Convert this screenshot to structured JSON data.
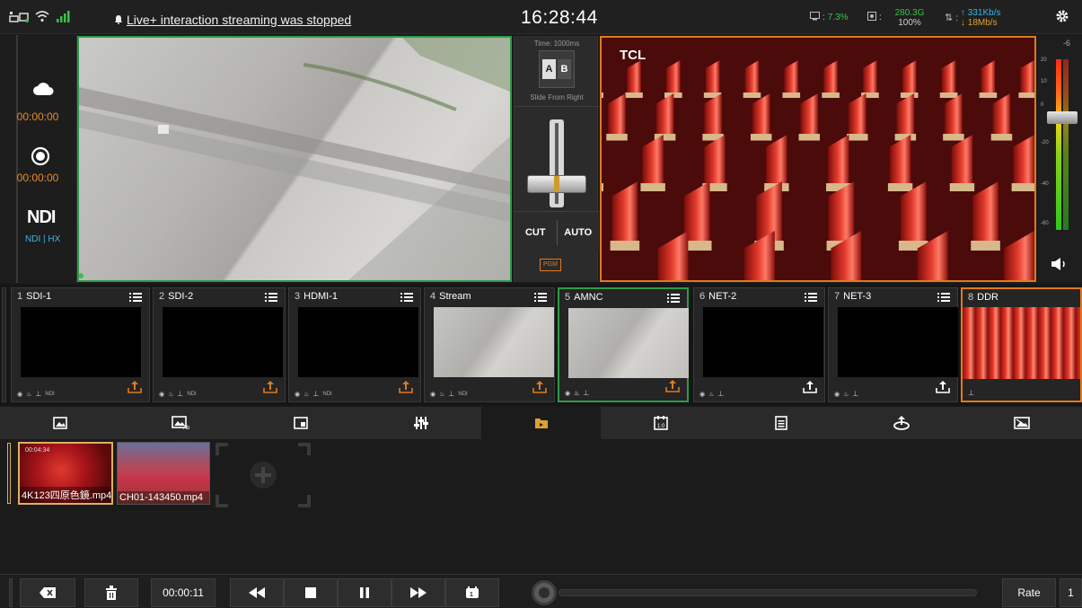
{
  "topbar": {
    "notice": "Live+ interaction streaming was stopped",
    "clock": "16:28:44",
    "cpu": "7.3%",
    "storage": "280.3G",
    "storage_pct": "100%",
    "upload": "331Kb/s",
    "download": "18Mb/s"
  },
  "left_panel": {
    "stream_time": "00:00:00",
    "record_time": "00:00:00",
    "ndi_logo": "NDI",
    "ndi_mode": "NDI | HX"
  },
  "transition": {
    "time": "Time: 1000ms",
    "a": "A",
    "b": "B",
    "effect": "Slide From Right",
    "cut": "CUT",
    "auto": "AUTO",
    "pgm": "PGM"
  },
  "program": {
    "brand": "TCL"
  },
  "audio": {
    "peak": "-6",
    "scale": [
      "20",
      "10",
      "0",
      "-20",
      "-40",
      "-60"
    ]
  },
  "sources": [
    {
      "num": "1",
      "name": "SDI-1",
      "tag": "NDI"
    },
    {
      "num": "2",
      "name": "SDI-2",
      "tag": "NDI"
    },
    {
      "num": "3",
      "name": "HDMI-1",
      "tag": "NDI"
    },
    {
      "num": "4",
      "name": "Stream",
      "tag": "NDI"
    },
    {
      "num": "5",
      "name": "AMNC",
      "tag": ""
    },
    {
      "num": "6",
      "name": "NET-2",
      "tag": ""
    },
    {
      "num": "7",
      "name": "NET-3",
      "tag": ""
    },
    {
      "num": "8",
      "name": "DDR",
      "tag": ""
    }
  ],
  "tabs": [
    "image-tab",
    "image-text-tab",
    "pip-tab",
    "mixer-tab",
    "folder-tab",
    "aspect-tab",
    "notes-tab",
    "stream-tab",
    "overlay-tab"
  ],
  "media": {
    "clips": [
      {
        "name": "4K123四原色鏡.mp4",
        "duration": "00:04:34"
      },
      {
        "name": "CH01-143450.mp4",
        "duration": ""
      }
    ]
  },
  "transport": {
    "time": "00:00:11",
    "rate_label": "Rate",
    "rate_value": "1"
  },
  "colors": {
    "preview_border": "#2f9a4a",
    "program_border": "#e07a20",
    "accent_blue": "#3bb5e6",
    "time_orange": "#e4892e"
  }
}
